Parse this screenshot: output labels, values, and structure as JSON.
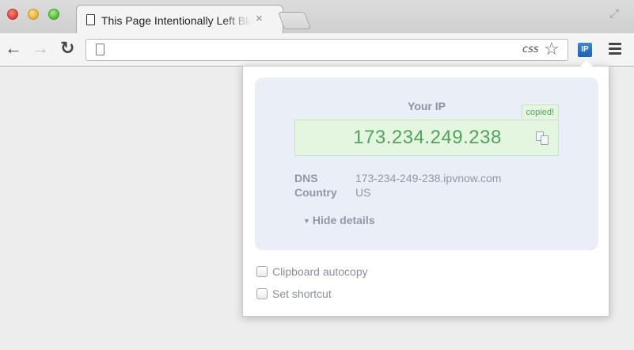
{
  "browser": {
    "tab_title": "This Page Intentionally Left Blank",
    "tab_close": "×",
    "address": "",
    "css_extension_label": "css",
    "ip_extension_label": "IP"
  },
  "popup": {
    "your_ip_label": "Your IP",
    "ip_address": "173.234.249.238",
    "copied_badge": "copied!",
    "details": [
      {
        "key": "DNS",
        "value": "173-234-249-238.ipvnow.com"
      },
      {
        "key": "Country",
        "value": "US"
      }
    ],
    "hide_details_label": "Hide details",
    "options": [
      {
        "label": "Clipboard autocopy",
        "checked": false
      },
      {
        "label": "Set shortcut",
        "checked": false
      }
    ]
  },
  "colors": {
    "ip_text": "#4ea55a",
    "panel_bg": "#eaeef6",
    "ip_box_bg": "#e4f6df",
    "extension_accent": "#1e62b3"
  },
  "icons": [
    "page-icon",
    "close-icon",
    "back-icon",
    "forward-icon",
    "reload-icon",
    "star-icon",
    "menu-icon",
    "copy-icon",
    "fullscreen-icon"
  ]
}
